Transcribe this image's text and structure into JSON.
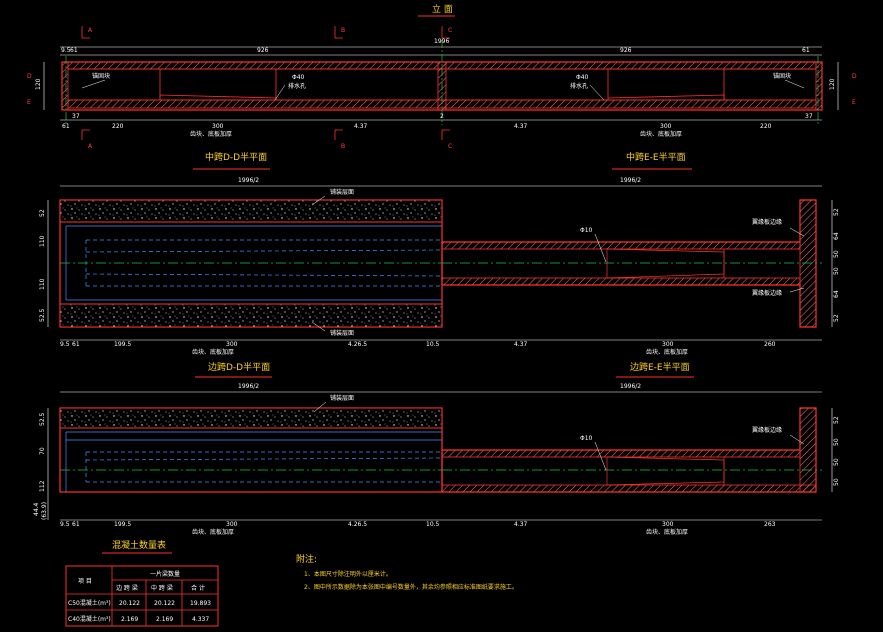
{
  "titles": {
    "elevation": "立 面",
    "mid_dd": "中跨D-D半平面",
    "mid_ee": "中跨E-E半平面",
    "side_dd": "边跨D-D半平面",
    "side_ee": "边跨E-E半平面",
    "quantity_table": "混凝土数量表",
    "notes_title": "附注:"
  },
  "section_labels": {
    "a": "A",
    "b": "B",
    "c": "C",
    "d": "D",
    "e": "E"
  },
  "elevation_dims": {
    "total": "1996",
    "left_small_a": "9.5",
    "left_small_b": "61",
    "half_left": "926",
    "half_right": "926",
    "right_small": "61",
    "height": "120",
    "bot_left_a": "61",
    "bot_left_b": "37",
    "bot_220_l": "220",
    "bot_300_l": "300",
    "bot_437_l": "4.37",
    "bot_center": "2",
    "bot_437_r": "4.37",
    "bot_300_r": "300",
    "bot_220_r": "220",
    "bot_right": "37"
  },
  "elevation_callouts": {
    "anchor_l": "锚固块",
    "anchor_r": "锚固块",
    "hole_l": "Φ40",
    "hole_l2": "排水孔",
    "hole_r": "Φ40",
    "hole_r2": "排水孔",
    "chamfer_note_l": "齿块、底板加厚",
    "chamfer_note_r": "齿块、底板加厚"
  },
  "plan_dims": {
    "half_total": "1996/2",
    "h_52_t": "52",
    "h_110_t": "110",
    "h_110_b": "110",
    "h_52_b": "52.5",
    "b_9": "9.5",
    "b_61": "61",
    "b_1995": "199.5",
    "b_300": "300",
    "b_4265": "4.26.5",
    "b_105": "10.5",
    "b_437": "4.37",
    "b_300r": "300",
    "b_260": "260",
    "r_52": "52",
    "r_64": "64",
    "r_50a": "50",
    "r_50b": "50",
    "r_64b": "64",
    "r_52b": "52",
    "cover_top": "铺装层面",
    "cover_bot": "铺装层面",
    "hole": "Φ10",
    "slab_edge_t": "翼缘板边缘",
    "slab_edge_b": "翼缘板边缘",
    "chamfer_note": "齿块、底板加厚"
  },
  "side_dims": {
    "half_total": "1996/2",
    "h_525": "52.5",
    "h_70": "70",
    "h_112": "112",
    "h_44": "44.4",
    "h_63": "(63.9)",
    "b_9": "9.5",
    "b_61": "61",
    "b_1995": "199.5",
    "b_300": "300",
    "b_4265": "4.26.5",
    "b_105": "10.5",
    "b_437": "4.37",
    "b_300r": "300",
    "b_263": "263",
    "r_52": "52",
    "r_50": "50",
    "r_50b": "50",
    "r_50c": "50",
    "cover": "铺装层面",
    "hole": "Φ10",
    "slab_edge": "翼缘板边缘",
    "chamfer_note": "齿块、底板加厚"
  },
  "table": {
    "col_header_name": "项 目",
    "col_group": "一片梁数量",
    "cols": [
      "边 跨 梁",
      "中 跨 梁",
      "合 计"
    ],
    "rows": [
      {
        "label": "C50混凝土(m³)",
        "values": [
          "20.122",
          "20.122",
          "19.893"
        ]
      },
      {
        "label": "C40混凝土(m³)",
        "values": [
          "2.169",
          "2.169",
          "4.337"
        ]
      }
    ]
  },
  "notes": [
    "1、本图尺寸除注明外以厘米计。",
    "2、图中所示数据除为本张图中编号数量外，其余均参照相应标准图纸要求施工。"
  ],
  "colors": {
    "concrete": "#ff3030",
    "hatch": "#ff8c8c",
    "dim": "#ffffff",
    "title": "#ffd21f",
    "centerline": "#20c040",
    "hidden": "#4a8cff"
  }
}
